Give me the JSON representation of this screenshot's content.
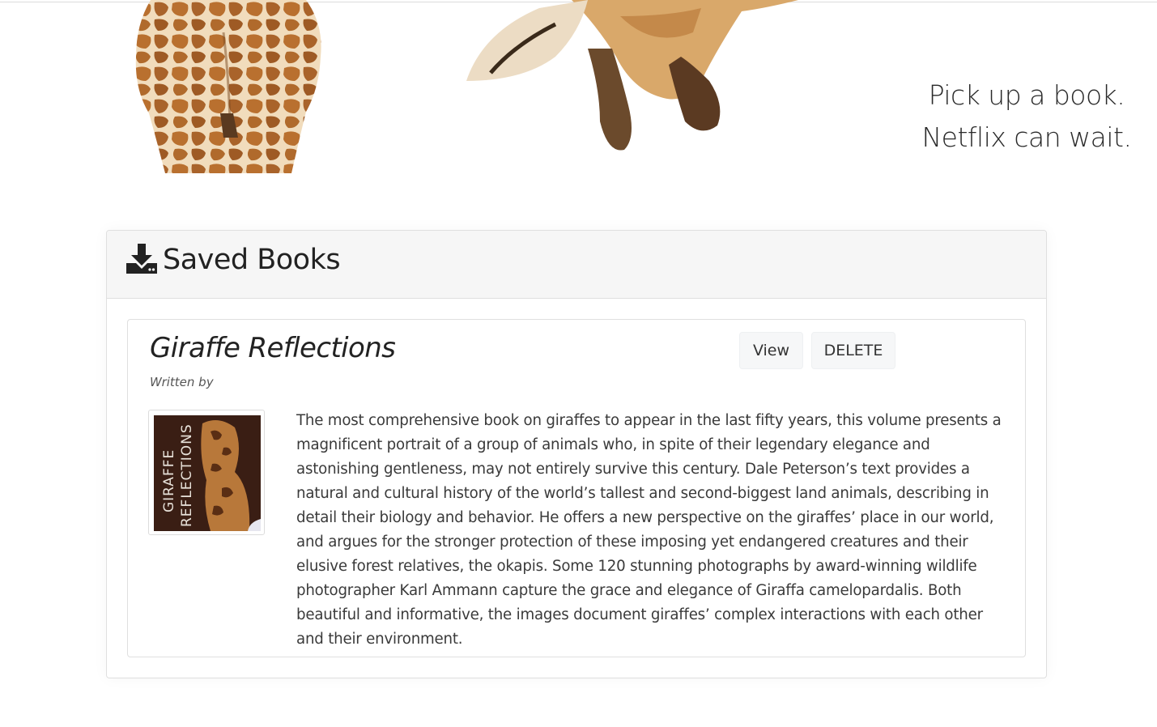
{
  "hero": {
    "tagline_line1": "Pick up a book.",
    "tagline_line2": "Netflix can wait."
  },
  "saved_books": {
    "header_title": "Saved Books",
    "header_icon": "download-icon",
    "books": [
      {
        "title": "Giraffe Reflections",
        "author_label": "Written by",
        "view_label": "View",
        "delete_label": "DELETE",
        "cover": {
          "line1": "GIRAFFE",
          "line2": "REFLECTIONS"
        },
        "description": "The most comprehensive book on giraffes to appear in the last fifty years, this volume presents a magnificent portrait of a group of animals who, in spite of their legendary elegance and astonishing gentleness, may not entirely survive this century. Dale Peterson’s text provides a natural and cultural history of the world’s tallest and second-biggest land animals, describing in detail their biology and behavior. He offers a new perspective on the giraffes’ place in our world, and argues for the stronger protection of these imposing yet endangered creatures and their elusive forest relatives, the okapis. Some 120 stunning photographs by award-winning wildlife photographer Karl Ammann capture the grace and elegance of Giraffa camelopardalis. Both beautiful and informative, the images document giraffes’ complex interactions with each other and their environment."
      }
    ]
  },
  "colors": {
    "giraffe_tan": "#e8c79a",
    "giraffe_spot": "#a8672c",
    "header_bg": "#f6f6f6",
    "border": "#dfdfdf"
  }
}
